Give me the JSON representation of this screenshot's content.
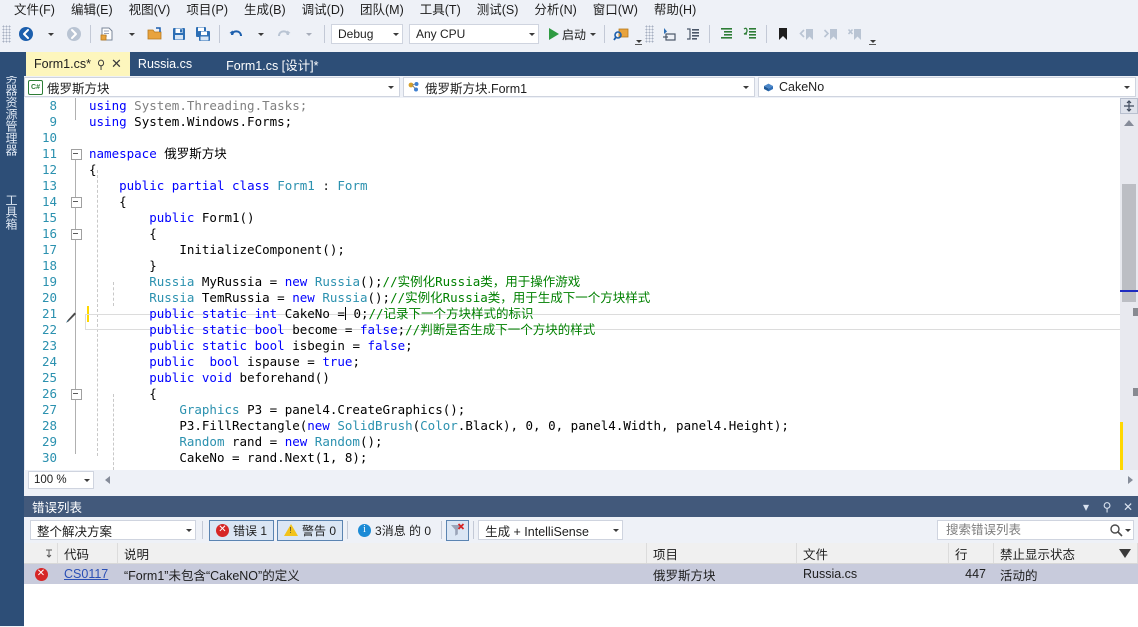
{
  "menu": {
    "items": [
      "文件(F)",
      "编辑(E)",
      "视图(V)",
      "项目(P)",
      "生成(B)",
      "调试(D)",
      "团队(M)",
      "工具(T)",
      "测试(S)",
      "分析(N)",
      "窗口(W)",
      "帮助(H)"
    ]
  },
  "toolbar": {
    "config": "Debug",
    "platform": "Any CPU",
    "run_label": "启动",
    "icons": [
      "navigate-back-icon",
      "navigate-forward-icon",
      "new-item-icon",
      "open-file-icon",
      "save-icon",
      "save-all-icon",
      "undo-icon",
      "redo-icon",
      "find-icon",
      "quick-launch-icon",
      "step-icon",
      "comment-icon",
      "indent-icon",
      "outdent-icon",
      "bookmark-icon",
      "prev-bookmark-icon",
      "next-bookmark-icon",
      "clear-bookmarks-icon"
    ]
  },
  "vdock": {
    "tabs": [
      "服务器资源管理器",
      "工具箱"
    ]
  },
  "tabs": [
    {
      "label": "Form1.cs*",
      "active": true
    },
    {
      "label": "Russia.cs",
      "active": false
    },
    {
      "label": "Form1.cs [设计]*",
      "active": false
    }
  ],
  "navbar": {
    "project": "俄罗斯方块",
    "class": "俄罗斯方块.Form1",
    "member": "CakeNo"
  },
  "editor": {
    "zoom": "100 %",
    "lines": [
      {
        "n": 8,
        "html": "<span class=\"k\">using</span> <span class=\"g\">System.Threading.Tasks;</span>"
      },
      {
        "n": 9,
        "html": "<span class=\"k\">using</span> <span class=\"p\">System.Windows.Forms;</span>"
      },
      {
        "n": 10,
        "html": ""
      },
      {
        "n": 11,
        "html": "<span class=\"k\">namespace</span> <span class=\"p\">俄罗斯方块</span>"
      },
      {
        "n": 12,
        "html": "<span class=\"p\">{</span>"
      },
      {
        "n": 13,
        "html": "    <span class=\"k\">public</span> <span class=\"k\">partial</span> <span class=\"k\">class</span> <span class=\"t\">Form1</span> : <span class=\"t\">Form</span>"
      },
      {
        "n": 14,
        "html": "    <span class=\"p\">{</span>"
      },
      {
        "n": 15,
        "html": "        <span class=\"k\">public</span> <span class=\"p\">Form1()</span>"
      },
      {
        "n": 16,
        "html": "        <span class=\"p\">{</span>"
      },
      {
        "n": 17,
        "html": "            <span class=\"p\">InitializeComponent();</span>"
      },
      {
        "n": 18,
        "html": "        <span class=\"p\">}</span>"
      },
      {
        "n": 19,
        "html": "        <span class=\"t\">Russia</span> <span class=\"p\">MyRussia = </span><span class=\"k\">new</span> <span class=\"t\">Russia</span><span class=\"p\">();</span><span class=\"c\">//实例化Russia类，用于操作游戏</span>"
      },
      {
        "n": 20,
        "html": "        <span class=\"t\">Russia</span> <span class=\"p\">TemRussia = </span><span class=\"k\">new</span> <span class=\"t\">Russia</span><span class=\"p\">();</span><span class=\"c\">//实例化Russia类，用于生成下一个方块样式</span>"
      },
      {
        "n": 21,
        "html": "        <span class=\"k\">public</span> <span class=\"k\">static</span> <span class=\"k\">int</span> <span class=\"p\">CakeNo =</span>"
      },
      {
        "n": 22,
        "html": "        <span class=\"k\">public</span> <span class=\"k\">static</span> <span class=\"k\">bool</span> <span class=\"p\">become = </span><span class=\"k\">false</span><span class=\"p\">;</span><span class=\"c\">//判断是否生成下一个方块的样式</span>"
      },
      {
        "n": 23,
        "html": "        <span class=\"k\">public</span> <span class=\"k\">static</span> <span class=\"k\">bool</span> <span class=\"p\">isbegin = </span><span class=\"k\">false</span><span class=\"p\">;</span>"
      },
      {
        "n": 24,
        "html": "        <span class=\"k\">public</span>  <span class=\"k\">bool</span> <span class=\"p\">ispause = </span><span class=\"k\">true</span><span class=\"p\">;</span>"
      },
      {
        "n": 25,
        "html": "        <span class=\"k\">public</span> <span class=\"k\">void</span> <span class=\"p\">beforehand()</span>"
      },
      {
        "n": 26,
        "html": "        <span class=\"p\">{</span>"
      },
      {
        "n": 27,
        "html": "            <span class=\"t\">Graphics</span> <span class=\"p\">P3 = panel4.CreateGraphics();</span>"
      },
      {
        "n": 28,
        "html": "            <span class=\"p\">P3.FillRectangle(</span><span class=\"k\">new</span> <span class=\"t\">SolidBrush</span><span class=\"p\">(</span><span class=\"t\">Color</span><span class=\"p\">.Black), 0, 0, panel4.Width, panel4.Height);</span>"
      },
      {
        "n": 29,
        "html": "            <span class=\"t\">Random</span> <span class=\"p\">rand = </span><span class=\"k\">new</span> <span class=\"t\">Random</span><span class=\"p\">();</span>"
      },
      {
        "n": 30,
        "html": "            <span class=\"p\">CakeNo = rand.Next(1, 8);</span>"
      }
    ],
    "line21_after_caret": " 0;",
    "line21_comment": "//记录下一个方块样式的标识"
  },
  "errorlist": {
    "title": "错误列表",
    "scope": "整个解决方案",
    "errors_label": "错误 1",
    "warnings_label": "警告 0",
    "messages_label": "3消息 的 0",
    "build_filter": "生成 + IntelliSense",
    "search_placeholder": "搜索错误列表",
    "search_value": "",
    "columns": [
      "代码",
      "说明",
      "项目",
      "文件",
      "行",
      "禁止显示状态"
    ],
    "rows": [
      {
        "severity": "error",
        "code": "CS0117",
        "description": "“Form1”未包含“CakeNO”的定义",
        "project": "俄罗斯方块",
        "file": "Russia.cs",
        "line": "447",
        "suppression": "活动的"
      }
    ]
  },
  "colors": {
    "accent": "#2d4e77",
    "panel_header": "#42597b",
    "active_tab": "#fdf6bd",
    "error_red": "#d62626",
    "warn_yellow": "#f2c31b",
    "info_blue": "#1c8bd6",
    "chrome": "#eef1f7"
  }
}
